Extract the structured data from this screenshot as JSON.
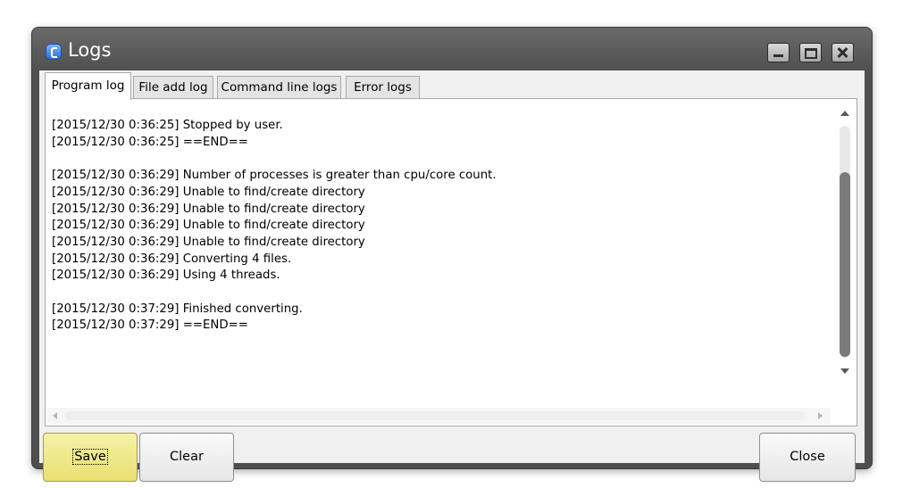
{
  "window": {
    "title": "Logs"
  },
  "tabs": [
    {
      "label": "Program log",
      "active": true
    },
    {
      "label": "File add log",
      "active": false
    },
    {
      "label": "Command line logs",
      "active": false
    },
    {
      "label": "Error logs",
      "active": false
    }
  ],
  "log_text": "[2015/12/30 0:36:25] Stopped by user.\n[2015/12/30 0:36:25] ==END==\n\n[2015/12/30 0:36:29] Number of processes is greater than cpu/core count.\n[2015/12/30 0:36:29] Unable to find/create directory\n[2015/12/30 0:36:29] Unable to find/create directory\n[2015/12/30 0:36:29] Unable to find/create directory\n[2015/12/30 0:36:29] Unable to find/create directory\n[2015/12/30 0:36:29] Converting 4 files.\n[2015/12/30 0:36:29] Using 4 threads.\n\n[2015/12/30 0:37:29] Finished converting.\n[2015/12/30 0:37:29] ==END==",
  "buttons": {
    "save": "Save",
    "clear": "Clear",
    "close": "Close"
  },
  "icons": {
    "app": "app-icon",
    "minimize": "minimize-icon",
    "maximize": "maximize-icon",
    "close": "close-icon"
  },
  "colors": {
    "titlebar": "#505050",
    "save_highlight": "#e9df70"
  }
}
